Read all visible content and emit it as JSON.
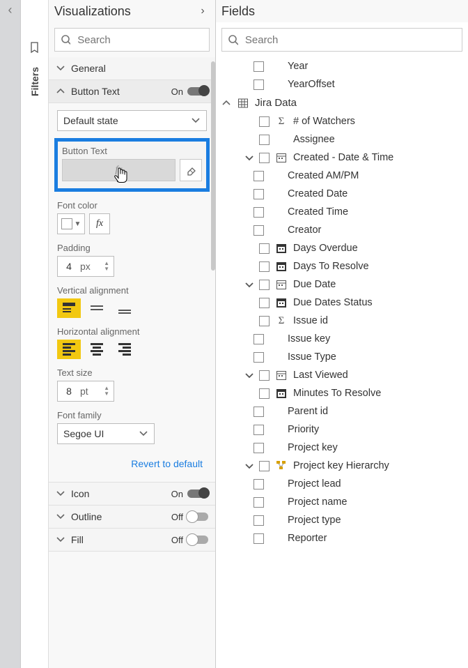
{
  "filters_label": "Filters",
  "viz": {
    "title": "Visualizations",
    "search_placeholder": "Search",
    "general_section": "General",
    "button_text_section": "Button Text",
    "on_label": "On",
    "off_label": "Off",
    "default_state": "Default state",
    "button_text_label": "Button Text",
    "fx_placeholder": "fx",
    "font_color_label": "Font color",
    "padding_label": "Padding",
    "padding_value": "4",
    "padding_unit": "px",
    "valign_label": "Vertical alignment",
    "halign_label": "Horizontal alignment",
    "text_size_label": "Text size",
    "text_size_value": "8",
    "text_size_unit": "pt",
    "font_family_label": "Font family",
    "font_family_value": "Segoe UI",
    "revert_label": "Revert to default",
    "icon_section": "Icon",
    "outline_section": "Outline",
    "fill_section": "Fill"
  },
  "fields": {
    "title": "Fields",
    "search_placeholder": "Search",
    "top": [
      {
        "label": "Year"
      },
      {
        "label": "YearOffset"
      }
    ],
    "group_label": "Jira Data",
    "items": [
      {
        "caret": "",
        "icon": "sigma",
        "label": "# of Watchers"
      },
      {
        "caret": "",
        "icon": "",
        "label": "Assignee"
      },
      {
        "caret": "down",
        "icon": "calendar",
        "label": "Created - Date & Time"
      },
      {
        "caret": "",
        "icon": "",
        "sub": true,
        "label": "Created AM/PM"
      },
      {
        "caret": "",
        "icon": "",
        "sub": true,
        "label": "Created Date"
      },
      {
        "caret": "",
        "icon": "",
        "sub": true,
        "label": "Created Time"
      },
      {
        "caret": "",
        "icon": "",
        "sub": true,
        "label": "Creator"
      },
      {
        "caret": "",
        "icon": "dcal",
        "label": "Days Overdue"
      },
      {
        "caret": "",
        "icon": "dcal",
        "label": "Days To Resolve"
      },
      {
        "caret": "down",
        "icon": "calendar",
        "label": "Due Date"
      },
      {
        "caret": "",
        "icon": "dcal",
        "label": "Due Dates Status"
      },
      {
        "caret": "",
        "icon": "sigma",
        "label": "Issue id"
      },
      {
        "caret": "",
        "icon": "",
        "sub": true,
        "label": "Issue key"
      },
      {
        "caret": "",
        "icon": "",
        "sub": true,
        "label": "Issue Type"
      },
      {
        "caret": "down",
        "icon": "calendar",
        "label": "Last Viewed"
      },
      {
        "caret": "",
        "icon": "dcal",
        "label": "Minutes To Resolve"
      },
      {
        "caret": "",
        "icon": "",
        "sub": true,
        "label": "Parent id"
      },
      {
        "caret": "",
        "icon": "",
        "sub": true,
        "label": "Priority"
      },
      {
        "caret": "",
        "icon": "",
        "sub": true,
        "label": "Project key"
      },
      {
        "caret": "down",
        "icon": "hierarchy",
        "label": "Project key Hierarchy"
      },
      {
        "caret": "",
        "icon": "",
        "sub": true,
        "label": "Project lead"
      },
      {
        "caret": "",
        "icon": "",
        "sub": true,
        "label": "Project name"
      },
      {
        "caret": "",
        "icon": "",
        "sub": true,
        "label": "Project type"
      },
      {
        "caret": "",
        "icon": "",
        "sub": true,
        "label": "Reporter"
      }
    ]
  }
}
